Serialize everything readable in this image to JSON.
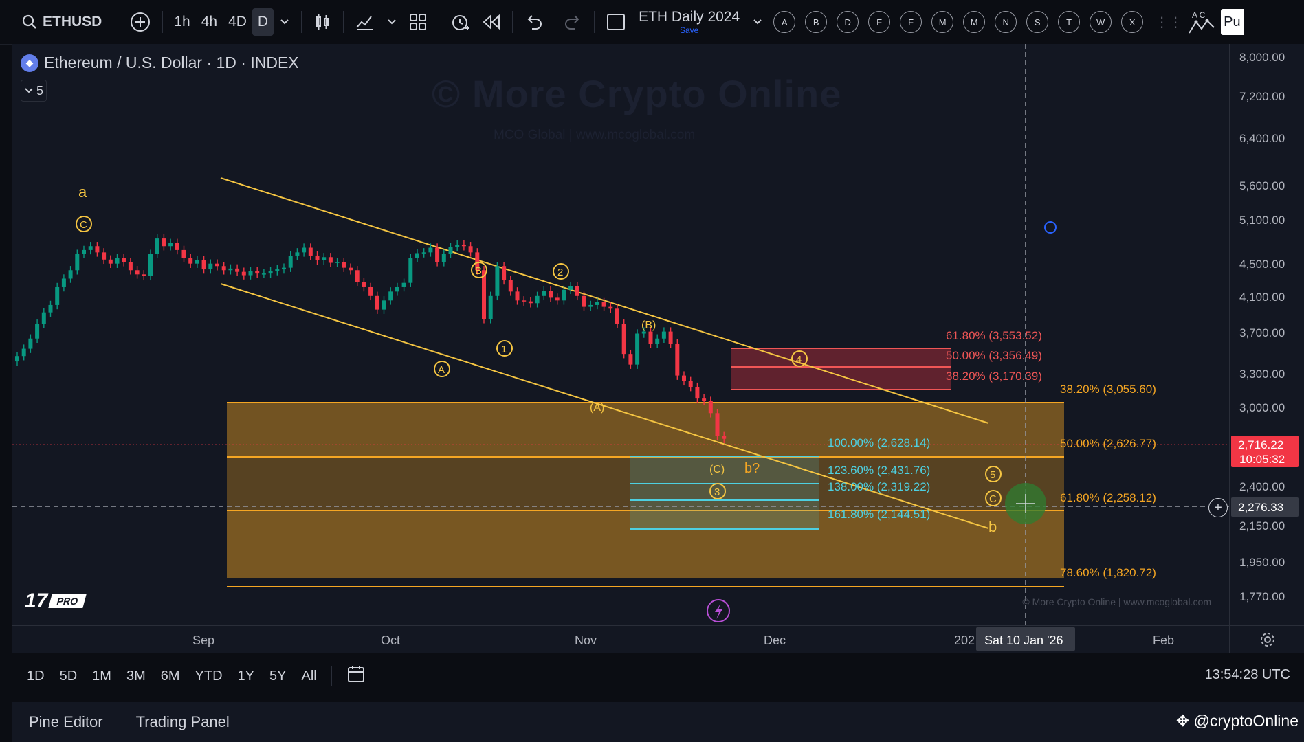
{
  "toolbar": {
    "symbol": "ETHUSD",
    "intervals": [
      "1h",
      "4h",
      "4D",
      "D"
    ],
    "active_interval": "D",
    "layout_name": "ETH Daily 2024",
    "layout_save": "Save",
    "drawing_letters": [
      "A",
      "B",
      "D",
      "F",
      "F",
      "M",
      "M",
      "N",
      "S",
      "T",
      "W",
      "X"
    ],
    "partial_label": "Pu"
  },
  "chart": {
    "legend_title": "Ethereum / U.S. Dollar · 1D · INDEX",
    "collapse_count": "5",
    "watermark_title": "© More Crypto Online",
    "watermark_sub": "MCO Global  |  www.mcoglobal.com",
    "copyright_note": "© More Crypto Online  |  www.mcoglobal.com",
    "tv_badge": "PRO",
    "wave_labels": {
      "a": "a",
      "c_circle": "C",
      "B_circle": "B",
      "A_circle": "A",
      "one": "1",
      "two": "2",
      "B_paren": "(B)",
      "A_paren": "(A)",
      "C_paren": "(C)",
      "b_q": "b?",
      "three": "3",
      "four": "4",
      "five": "5",
      "c_circle2": "C",
      "b": "b"
    },
    "fib_right": [
      {
        "label": "61.80% (3,553.52)",
        "color": "#f05656"
      },
      {
        "label": "50.00% (3,356.49)",
        "color": "#f05656"
      },
      {
        "label": "38.20% (3,170.39)",
        "color": "#f05656"
      },
      {
        "label": "38.20% (3,055.60)",
        "color": "#f5a623"
      },
      {
        "label": "50.00% (2,626.77)",
        "color": "#f5a623"
      },
      {
        "label": "61.80% (2,258.12)",
        "color": "#f5a623"
      },
      {
        "label": "78.60% (1,820.72)",
        "color": "#f5a623"
      }
    ],
    "fib_ext": [
      "100.00% (2,628.14)",
      "123.60% (2,431.76)",
      "138.00% (2,319.22)",
      "161.80% (2,144.51)"
    ],
    "colors": {
      "up": "#089981",
      "down": "#f23645",
      "channel": "#f5c542",
      "fib_orange": "#f5a623",
      "fib_red": "#f05656",
      "fib_cyan": "#4dd0e1"
    }
  },
  "price_axis": {
    "ticks": [
      "8,000.00",
      "7,200.00",
      "6,400.00",
      "5,600.00",
      "5,100.00",
      "4,500.00",
      "4,100.00",
      "3,700.00",
      "3,300.00",
      "3,000.00",
      "2,400.00",
      "2,150.00",
      "1,950.00",
      "1,770.00"
    ],
    "last_price": "2,716.22",
    "countdown": "10:05:32",
    "crosshair_price": "2,276.33"
  },
  "time_axis": {
    "labels": [
      "Sep",
      "Oct",
      "Nov",
      "Dec",
      "202",
      "Feb"
    ],
    "crosshair_date": "Sat 10 Jan '26"
  },
  "bottom": {
    "ranges": [
      "1D",
      "5D",
      "1M",
      "3M",
      "6M",
      "YTD",
      "1Y",
      "5Y",
      "All"
    ],
    "clock": "13:54:28 UTC",
    "panels": [
      "Pine Editor",
      "Trading Panel"
    ],
    "handle": "@cryptoOnline"
  },
  "chart_data": {
    "type": "candlestick",
    "symbol": "ETHUSD",
    "interval": "1D",
    "ylim": [
      1700,
      8000
    ],
    "y_scale": "log",
    "x_labels": [
      "Sep",
      "Oct",
      "Nov",
      "Dec",
      "Feb"
    ],
    "closes_approx": [
      3380,
      3450,
      3550,
      3700,
      3820,
      3900,
      4100,
      4200,
      4300,
      4500,
      4550,
      4600,
      4520,
      4430,
      4380,
      4450,
      4400,
      4300,
      4250,
      4230,
      4500,
      4700,
      4600,
      4640,
      4550,
      4450,
      4380,
      4420,
      4310,
      4380,
      4350,
      4300,
      4320,
      4280,
      4240,
      4290,
      4260,
      4260,
      4290,
      4310,
      4330,
      4480,
      4520,
      4580,
      4480,
      4420,
      4460,
      4390,
      4400,
      4330,
      4300,
      4160,
      4100,
      4000,
      3850,
      3950,
      4050,
      4100,
      4150,
      4450,
      4510,
      4520,
      4580,
      4400,
      4500,
      4590,
      4620,
      4600,
      4520,
      4300,
      3750,
      4000,
      4350,
      4180,
      4050,
      3950,
      3940,
      3920,
      4000,
      4060,
      3980,
      3950,
      4070,
      4110,
      4000,
      3880,
      3900,
      3930,
      3880,
      3860,
      3700,
      3400,
      3300,
      3600,
      3620,
      3500,
      3550,
      3620,
      3500,
      3200,
      3150,
      3100,
      3000,
      2980,
      2880,
      2700,
      2680
    ]
  }
}
